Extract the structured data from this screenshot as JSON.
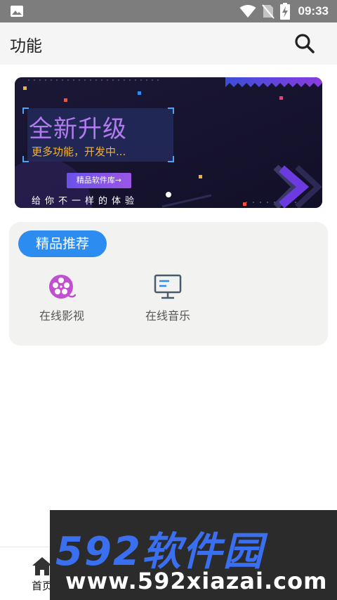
{
  "status_bar": {
    "time": "09:33"
  },
  "app_bar": {
    "title": "功能"
  },
  "banner": {
    "title": "全新升级",
    "subtitle": "更多功能，开发中...",
    "button_label": "精品软件库→",
    "slogan": "给你不一样的体验"
  },
  "recommend": {
    "tag": "精品推荐",
    "items": [
      {
        "label": "在线影视",
        "icon": "film-reel-icon"
      },
      {
        "label": "在线音乐",
        "icon": "monitor-icon"
      }
    ]
  },
  "bottom_nav": {
    "home_label": "首页"
  },
  "watermark": {
    "logo": "592软件园",
    "url": "www.592xiazai.com"
  },
  "colors": {
    "accent_blue": "#2d8cf0",
    "banner_purple": "#b37bf0",
    "banner_orange": "#f2b234",
    "film_icon": "#c24fd1"
  }
}
